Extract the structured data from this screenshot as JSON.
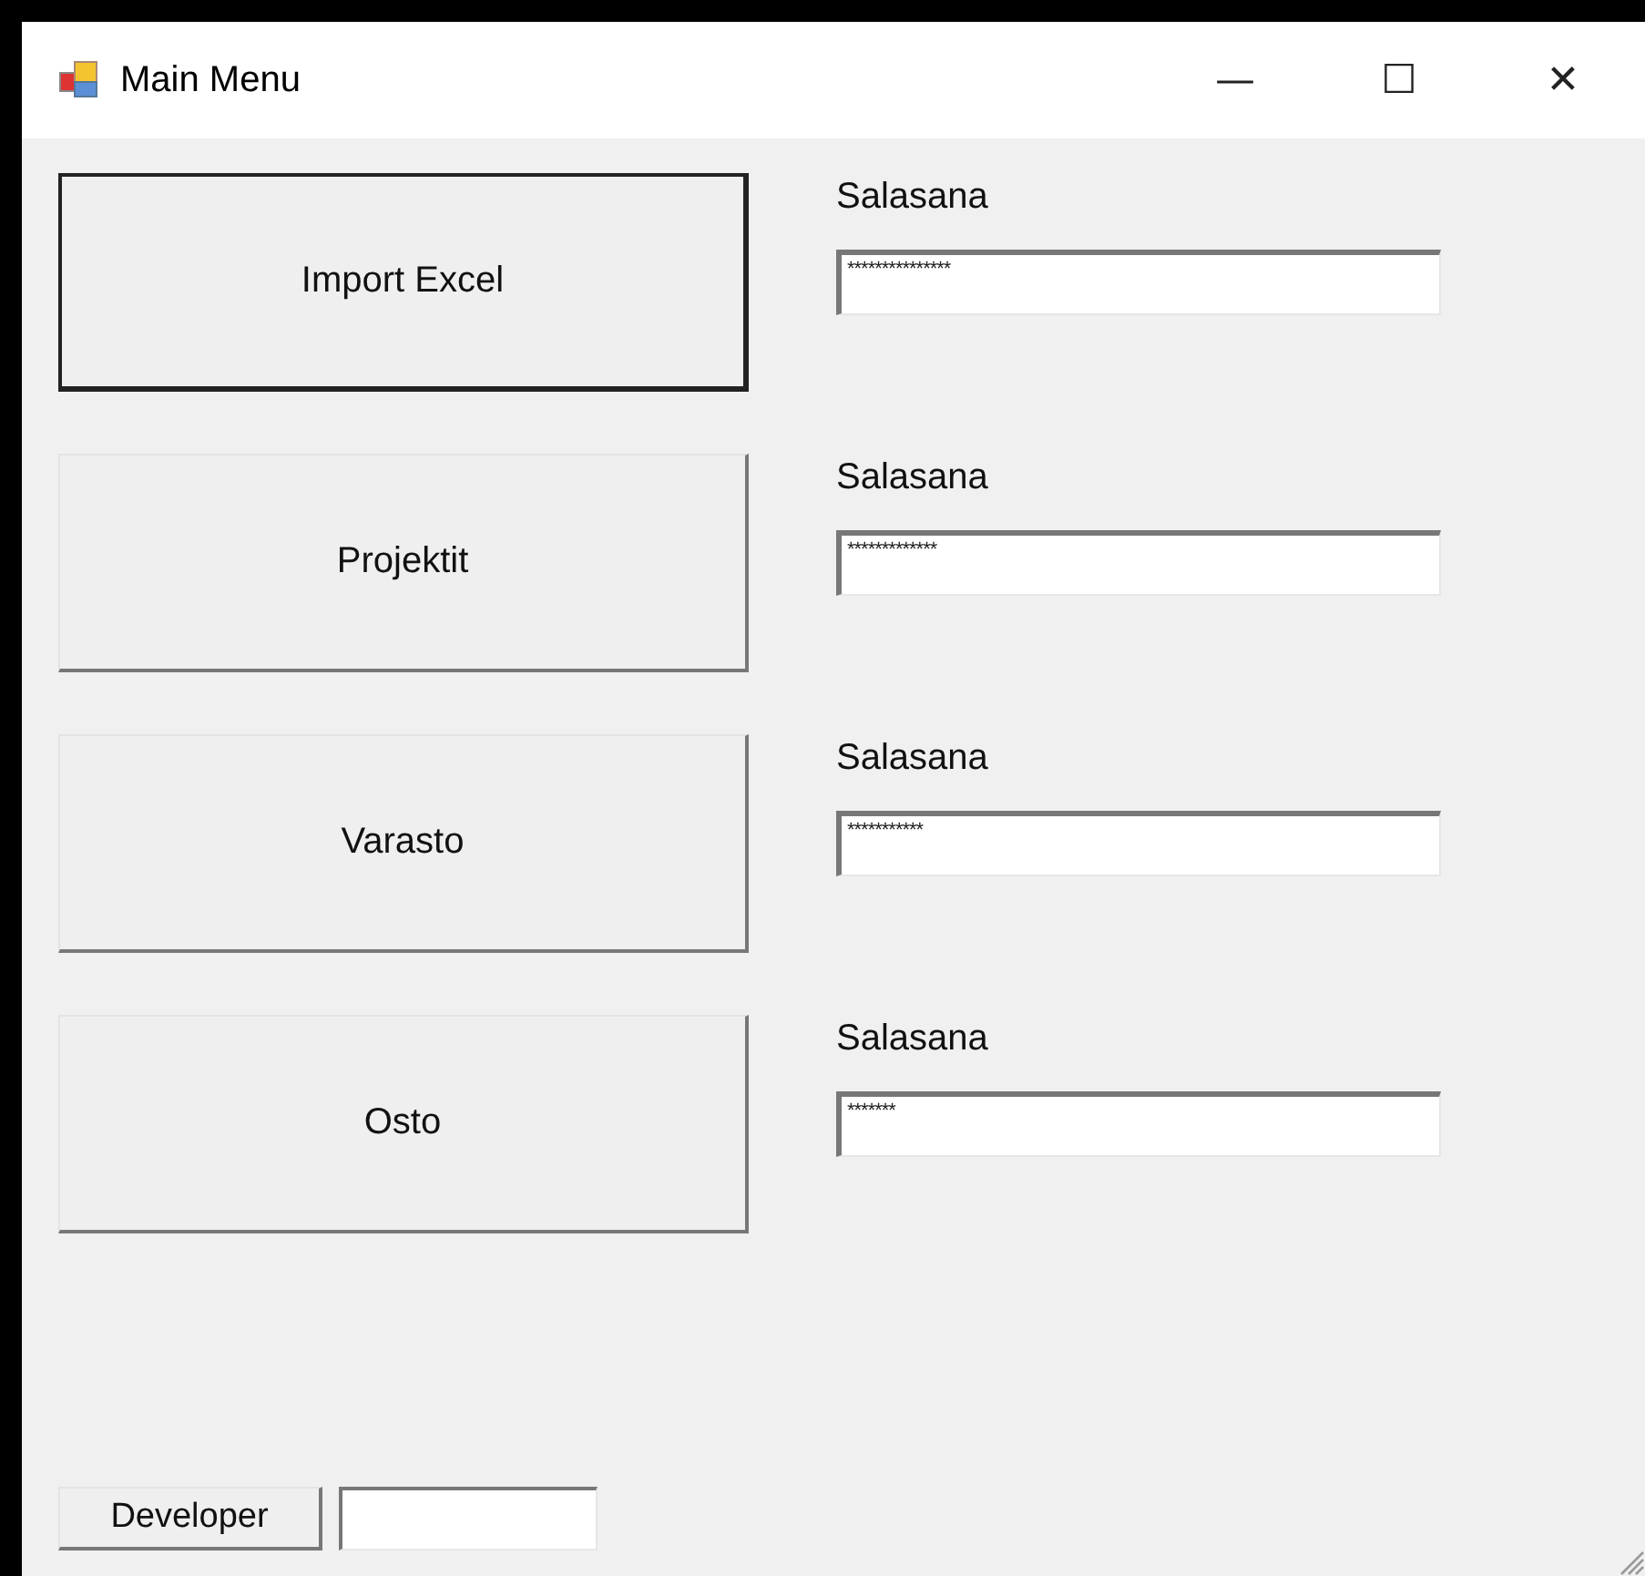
{
  "window": {
    "title": "Main Menu",
    "controls": [
      "—",
      "☐",
      "✕"
    ]
  },
  "rows": [
    {
      "button": "Import Excel",
      "focused": true,
      "label": "Salasana",
      "password": "***************"
    },
    {
      "button": "Projektit",
      "focused": false,
      "label": "Salasana",
      "password": "*************"
    },
    {
      "button": "Varasto",
      "focused": false,
      "label": "Salasana",
      "password": "***********"
    },
    {
      "button": "Osto",
      "focused": false,
      "label": "Salasana",
      "password": "*******"
    }
  ],
  "footer": {
    "button": "Developer"
  }
}
